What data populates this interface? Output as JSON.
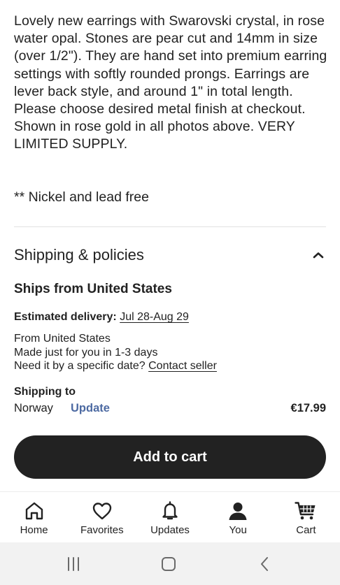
{
  "listing": {
    "description": "Lovely new earrings with Swarovski crystal, in rose water opal. Stones are pear cut and 14mm in size (over 1/2\"). They are hand set into premium earring settings with softly rounded prongs. Earrings are lever back style, and around 1\" in total length.  Please choose desired metal finish at checkout. Shown in rose gold in all photos above. VERY LIMITED SUPPLY.",
    "nickel_note": "** Nickel and lead free"
  },
  "shipping": {
    "section_title": "Shipping & policies",
    "ships_from": "Ships from United States",
    "estimated_label": "Estimated delivery:",
    "estimated_dates": "Jul 28-Aug 29",
    "from_line": "From United States",
    "made_line": "Made just for you in 1-3 days",
    "need_by_text": "Need it by a specific date?",
    "contact_link": "Contact seller",
    "ship_to_label": "Shipping to",
    "country": "Norway",
    "update_label": "Update",
    "price": "€17.99"
  },
  "cart_button": {
    "label": "Add to cart"
  },
  "tabbar": {
    "items": [
      {
        "label": "Home",
        "icon": "home-icon"
      },
      {
        "label": "Favorites",
        "icon": "heart-icon"
      },
      {
        "label": "Updates",
        "icon": "bell-icon"
      },
      {
        "label": "You",
        "icon": "person-icon"
      },
      {
        "label": "Cart",
        "icon": "cart-icon"
      }
    ]
  },
  "system_nav": {
    "icons": [
      "recent-apps-icon",
      "home-circle-icon",
      "back-icon"
    ]
  },
  "colors": {
    "primary_button": "#222222",
    "link_blue": "#4d6aa2",
    "nav_bg": "#f2f2f2"
  }
}
